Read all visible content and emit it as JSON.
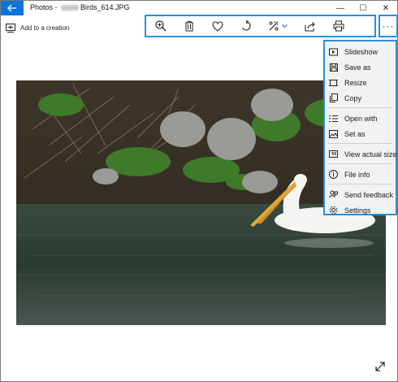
{
  "window": {
    "app_name": "Photos",
    "file_name": "Birds_614.JPG",
    "title_sep": " - ",
    "controls": {
      "minimize": "—",
      "maximize": "☐",
      "close": "✕"
    }
  },
  "left_toolbar": {
    "add_to_creation": "Add to a creation"
  },
  "toolbar_icons": [
    "zoom-in-icon",
    "delete-icon",
    "favorite-icon",
    "rotate-icon",
    "edit-icon",
    "share-icon",
    "print-icon"
  ],
  "more_label": "···",
  "menu": {
    "groups": [
      [
        {
          "label": "Slideshow",
          "icon": "slideshow-icon"
        },
        {
          "label": "Save as",
          "icon": "save-icon"
        },
        {
          "label": "Resize",
          "icon": "resize-icon"
        },
        {
          "label": "Copy",
          "icon": "copy-icon"
        }
      ],
      [
        {
          "label": "Open with",
          "icon": "open-with-icon"
        },
        {
          "label": "Set as",
          "icon": "set-as-icon"
        }
      ],
      [
        {
          "label": "View actual size",
          "icon": "actual-size-icon"
        }
      ],
      [
        {
          "label": "File info",
          "icon": "info-icon"
        }
      ],
      [
        {
          "label": "Send feedback",
          "icon": "feedback-icon"
        },
        {
          "label": "Settings",
          "icon": "settings-icon"
        }
      ]
    ]
  },
  "colors": {
    "accent": "#0a74d8",
    "highlight_border": "#2b8fd6",
    "menu_bg": "#f2f2f2"
  }
}
